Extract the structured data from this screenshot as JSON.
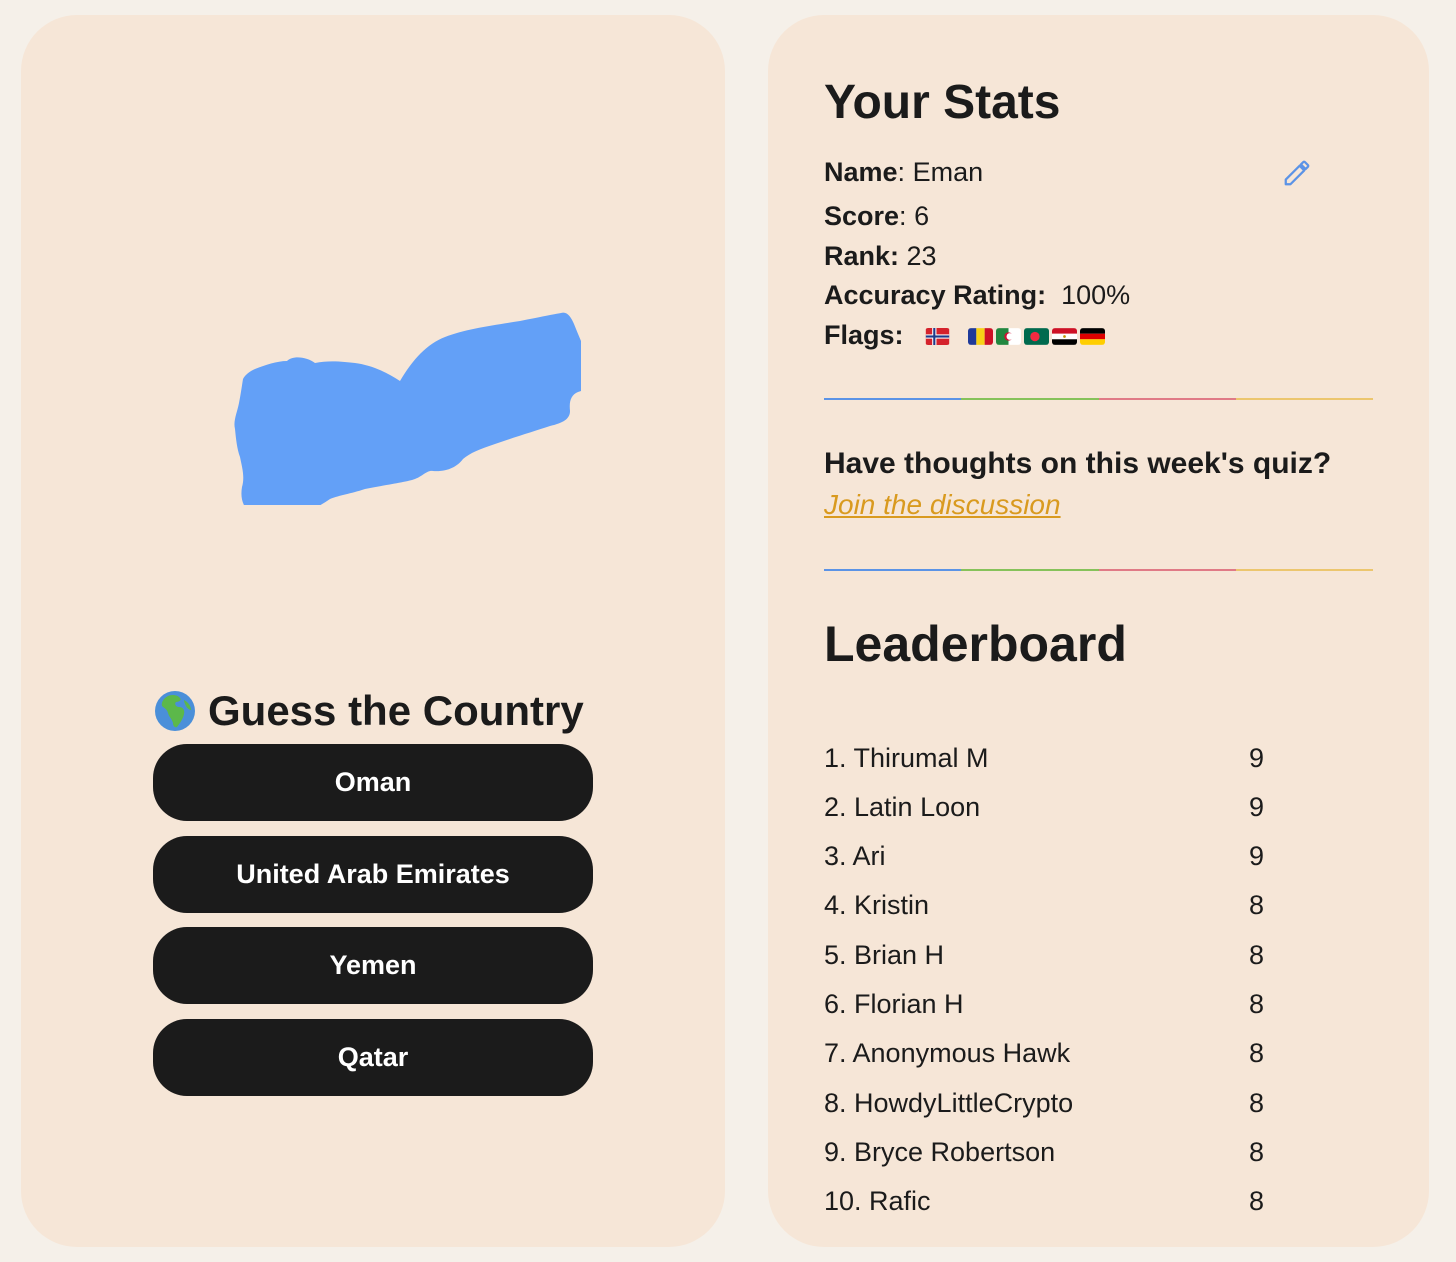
{
  "quiz": {
    "title": "Guess the Country",
    "globe_icon": "globe-europe-africa-icon",
    "map_color": "#63a0f7",
    "options": [
      "Oman",
      "United Arab Emirates",
      "Yemen",
      "Qatar"
    ]
  },
  "stats": {
    "title": "Your Stats",
    "name_label": "Name",
    "name_value": "Eman",
    "score_label": "Score",
    "score_value": "6",
    "rank_label": "Rank:",
    "rank_value": "23",
    "accuracy_label": "Accuracy Rating:",
    "accuracy_value": "100%",
    "flags_label": "Flags:",
    "flags": [
      "norway",
      "romania",
      "algeria",
      "bangladesh",
      "egypt",
      "germany"
    ],
    "edit_icon": "pencil-icon"
  },
  "feedback": {
    "question": "Have thoughts on this week's quiz?",
    "link_text": "Join the discussion"
  },
  "divider_colors": [
    "#5b93e6",
    "#86c25a",
    "#e07a86",
    "#ecc66e"
  ],
  "leaderboard": {
    "title": "Leaderboard",
    "entries": [
      {
        "name": "1. Thirumal M",
        "score": "9"
      },
      {
        "name": "2. Latin Loon",
        "score": "9"
      },
      {
        "name": "3. Ari",
        "score": "9"
      },
      {
        "name": "4. Kristin",
        "score": "8"
      },
      {
        "name": "5. Brian H",
        "score": "8"
      },
      {
        "name": "6. Florian H",
        "score": "8"
      },
      {
        "name": "7. Anonymous Hawk",
        "score": "8"
      },
      {
        "name": "8. HowdyLittleCrypto",
        "score": "8"
      },
      {
        "name": "9. Bryce Robertson",
        "score": "8"
      },
      {
        "name": "10. Rafic",
        "score": "8"
      }
    ]
  }
}
